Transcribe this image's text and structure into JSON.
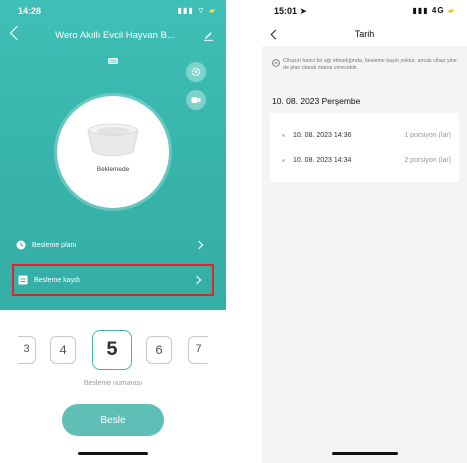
{
  "left": {
    "status": {
      "time": "14:28",
      "icons": "▮▮▮ ⌔"
    },
    "title": "Wero Akıllı Evcil Hayvan B...",
    "bowl_status": "Beklemede",
    "menu": {
      "plan_label": "Besleme planı",
      "log_label": "Besleme kaydı"
    },
    "picker": {
      "numbers": [
        "3",
        "4",
        "5",
        "6",
        "7"
      ],
      "selected": "5",
      "caption": "Besleme numarası"
    },
    "feed_button": "Besle"
  },
  "right": {
    "status": {
      "time": "15:01",
      "signal": "▮▮▮ 4G"
    },
    "title": "Tarih",
    "note": "Cihazın harici bir ağı olmadığında, besleme kaydı yoktur, ancak cihaz yine de plan olarak mama verecektir.",
    "date_heading": "10. 08. 2023 Perşembe",
    "records": [
      {
        "time": "10. 08. 2023 14:36",
        "portion": "1 porsiyon (lar)"
      },
      {
        "time": "10. 08. 2023 14:34",
        "portion": "2 porsiyon (lar)"
      }
    ]
  },
  "colors": {
    "teal": "#3fbfb7",
    "highlight_red": "#e0252a",
    "button_teal": "#5fbfb6"
  },
  "icons": [
    "back-chevron-icon",
    "edit-icon",
    "gear-icon",
    "camera-icon",
    "clock-icon",
    "list-icon",
    "chevron-right-icon",
    "info-icon"
  ]
}
